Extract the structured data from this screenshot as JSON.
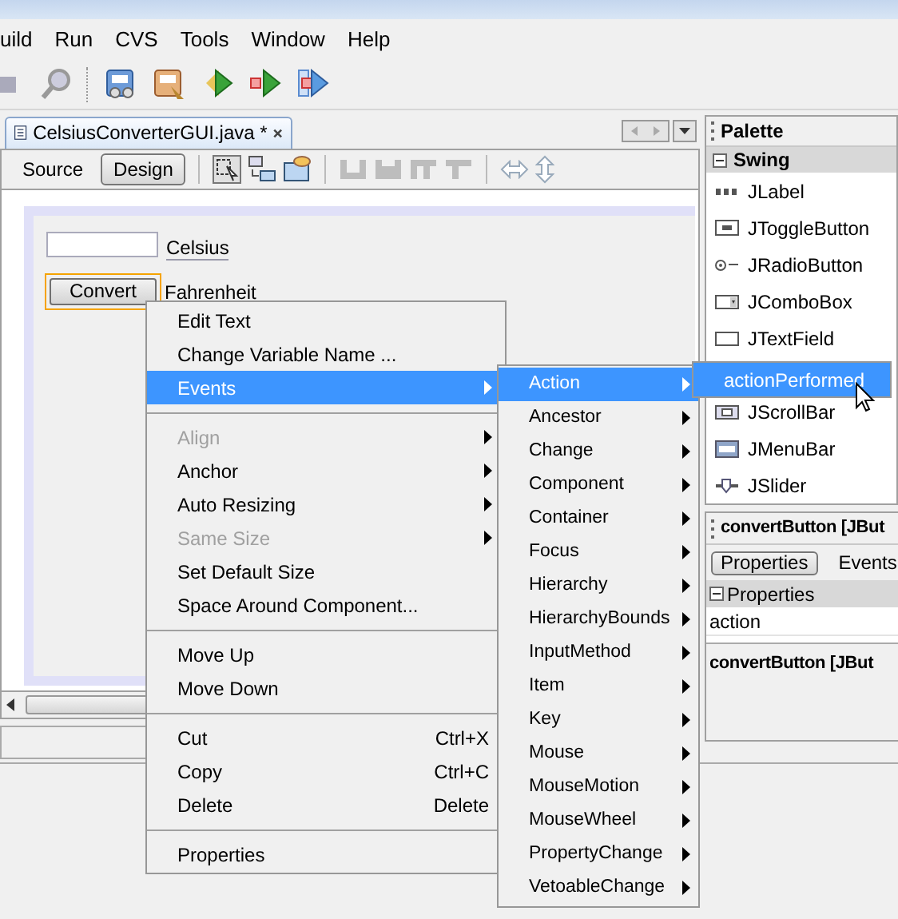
{
  "menubar": [
    "uild",
    "Run",
    "CVS",
    "Tools",
    "Window",
    "Help"
  ],
  "editor": {
    "tab_title": "CelsiusConverterGUI.java *",
    "views": [
      {
        "label": "Source",
        "selected": false
      },
      {
        "label": "Design",
        "selected": true
      }
    ],
    "form": {
      "celsius_label": "Celsius",
      "button_label": "Convert",
      "fahrenheit_label": "Fahrenheit",
      "button_selected": true
    }
  },
  "context_menu": {
    "items": [
      {
        "kind": "item",
        "label": "Edit Text",
        "disabled": false,
        "selected": false,
        "submenu": false
      },
      {
        "kind": "item",
        "label": "Change Variable Name ...",
        "disabled": false,
        "selected": false,
        "submenu": false
      },
      {
        "kind": "item",
        "label": "Events",
        "disabled": false,
        "selected": true,
        "submenu": true
      },
      {
        "kind": "separator"
      },
      {
        "kind": "item",
        "label": "Align",
        "disabled": true,
        "selected": false,
        "submenu": true
      },
      {
        "kind": "item",
        "label": "Anchor",
        "disabled": false,
        "selected": false,
        "submenu": true
      },
      {
        "kind": "item",
        "label": "Auto Resizing",
        "disabled": false,
        "selected": false,
        "submenu": true
      },
      {
        "kind": "item",
        "label": "Same Size",
        "disabled": true,
        "selected": false,
        "submenu": true
      },
      {
        "kind": "item",
        "label": "Set Default Size",
        "disabled": false,
        "selected": false,
        "submenu": false
      },
      {
        "kind": "item",
        "label": "Space Around Component...",
        "disabled": false,
        "selected": false,
        "submenu": false
      },
      {
        "kind": "separator"
      },
      {
        "kind": "item",
        "label": "Move Up",
        "disabled": false,
        "selected": false,
        "submenu": false
      },
      {
        "kind": "item",
        "label": "Move Down",
        "disabled": false,
        "selected": false,
        "submenu": false
      },
      {
        "kind": "separator"
      },
      {
        "kind": "item",
        "label": "Cut",
        "shortcut": "Ctrl+X",
        "disabled": false,
        "selected": false,
        "submenu": false
      },
      {
        "kind": "item",
        "label": "Copy",
        "shortcut": "Ctrl+C",
        "disabled": false,
        "selected": false,
        "submenu": false
      },
      {
        "kind": "item",
        "label": "Delete",
        "shortcut": "Delete",
        "disabled": false,
        "selected": false,
        "submenu": false
      },
      {
        "kind": "separator"
      },
      {
        "kind": "item",
        "label": "Properties",
        "disabled": false,
        "selected": false,
        "submenu": false
      }
    ]
  },
  "events_menu": {
    "items": [
      {
        "label": "Action",
        "selected": true
      },
      {
        "label": "Ancestor",
        "selected": false
      },
      {
        "label": "Change",
        "selected": false
      },
      {
        "label": "Component",
        "selected": false
      },
      {
        "label": "Container",
        "selected": false
      },
      {
        "label": "Focus",
        "selected": false
      },
      {
        "label": "Hierarchy",
        "selected": false
      },
      {
        "label": "HierarchyBounds",
        "selected": false
      },
      {
        "label": "InputMethod",
        "selected": false
      },
      {
        "label": "Item",
        "selected": false
      },
      {
        "label": "Key",
        "selected": false
      },
      {
        "label": "Mouse",
        "selected": false
      },
      {
        "label": "MouseMotion",
        "selected": false
      },
      {
        "label": "MouseWheel",
        "selected": false
      },
      {
        "label": "PropertyChange",
        "selected": false
      },
      {
        "label": "VetoableChange",
        "selected": false
      }
    ]
  },
  "action_menu": {
    "items": [
      {
        "label": "actionPerformed",
        "selected": true
      }
    ]
  },
  "palette": {
    "title": "Palette",
    "section": {
      "title": "Swing",
      "expanded": true
    },
    "items": [
      {
        "label": "JLabel",
        "gap_before": false
      },
      {
        "label": "JToggleButton",
        "gap_before": false
      },
      {
        "label": "JRadioButton",
        "gap_before": false
      },
      {
        "label": "JComboBox",
        "gap_before": false
      },
      {
        "label": "JTextField",
        "gap_before": false
      },
      {
        "label": "JScrollBar",
        "gap_before": true
      },
      {
        "label": "JMenuBar",
        "gap_before": false
      },
      {
        "label": "JSlider",
        "gap_before": false
      }
    ]
  },
  "properties_panel": {
    "title": "convertButton [JBut",
    "tabs": [
      {
        "label": "Properties",
        "selected": true
      },
      {
        "label": "Events",
        "selected": false
      }
    ],
    "section": {
      "title": "Properties",
      "expanded": true
    },
    "rows": [
      "action"
    ],
    "help_title": "convertButton [JBut"
  }
}
